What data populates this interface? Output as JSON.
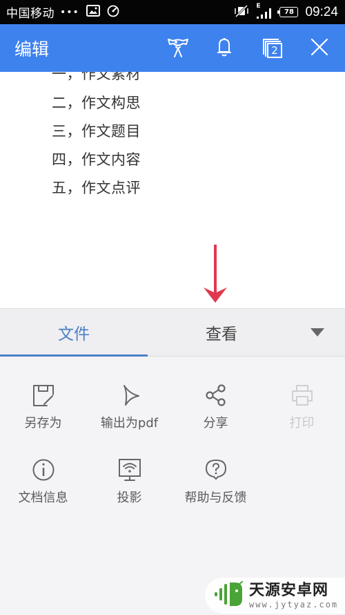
{
  "status_bar": {
    "carrier": "中国移动",
    "more_dots": "•••",
    "network_type": "E",
    "battery_level": "78",
    "time": "09:24",
    "icons": [
      "image-icon",
      "speedometer-icon",
      "vibrate-off-icon",
      "signal-icon",
      "battery-icon"
    ]
  },
  "app_bar": {
    "title": "编辑",
    "tab_count": "2",
    "icons": [
      "mascot-icon",
      "bell-icon",
      "tabs-icon",
      "close-icon"
    ],
    "color": "#3e82ee"
  },
  "document": {
    "lines": [
      "一，作文素材",
      "二，作文构思",
      "三，作文题目",
      "四，作文内容",
      "五，作文点评"
    ]
  },
  "annotation": {
    "arrow_color": "#e0384f"
  },
  "toolbar": {
    "tabs": [
      {
        "label": "文件",
        "active": true
      },
      {
        "label": "查看",
        "active": false
      }
    ],
    "accent_color": "#4a7fc6"
  },
  "menu": {
    "items": [
      {
        "label": "另存为",
        "icon": "save-as-icon",
        "enabled": true
      },
      {
        "label": "输出为pdf",
        "icon": "export-pdf-icon",
        "enabled": true
      },
      {
        "label": "分享",
        "icon": "share-icon",
        "enabled": true
      },
      {
        "label": "打印",
        "icon": "print-icon",
        "enabled": false
      },
      {
        "label": "文档信息",
        "icon": "info-icon",
        "enabled": true
      },
      {
        "label": "投影",
        "icon": "projection-icon",
        "enabled": true
      },
      {
        "label": "帮助与反馈",
        "icon": "help-feedback-icon",
        "enabled": true
      }
    ]
  },
  "watermark": {
    "title": "天源安卓网",
    "url": "www.jytyaz.com"
  }
}
